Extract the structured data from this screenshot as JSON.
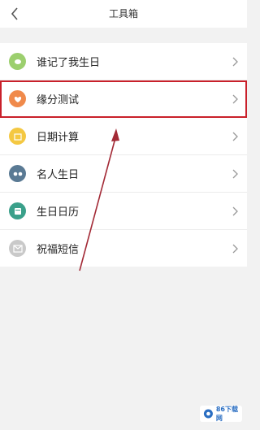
{
  "header": {
    "title": "工具箱",
    "back_icon": "chevron-left-icon"
  },
  "tools": [
    {
      "label": "谁记了我生日",
      "icon": "leaf-icon",
      "color": "#9ccf6e"
    },
    {
      "label": "缘分测试",
      "icon": "heart-icon",
      "color": "#f08a4b"
    },
    {
      "label": "日期计算",
      "icon": "calendar-icon",
      "color": "#f4c842"
    },
    {
      "label": "名人生日",
      "icon": "mask-icon",
      "color": "#5a7a94"
    },
    {
      "label": "生日日历",
      "icon": "calendar-book-icon",
      "color": "#3aa08a"
    },
    {
      "label": "祝福短信",
      "icon": "envelope-icon",
      "color": "#c9c9c9"
    }
  ],
  "highlight_color": "#c9202a",
  "watermark": {
    "text": "86下载网"
  }
}
